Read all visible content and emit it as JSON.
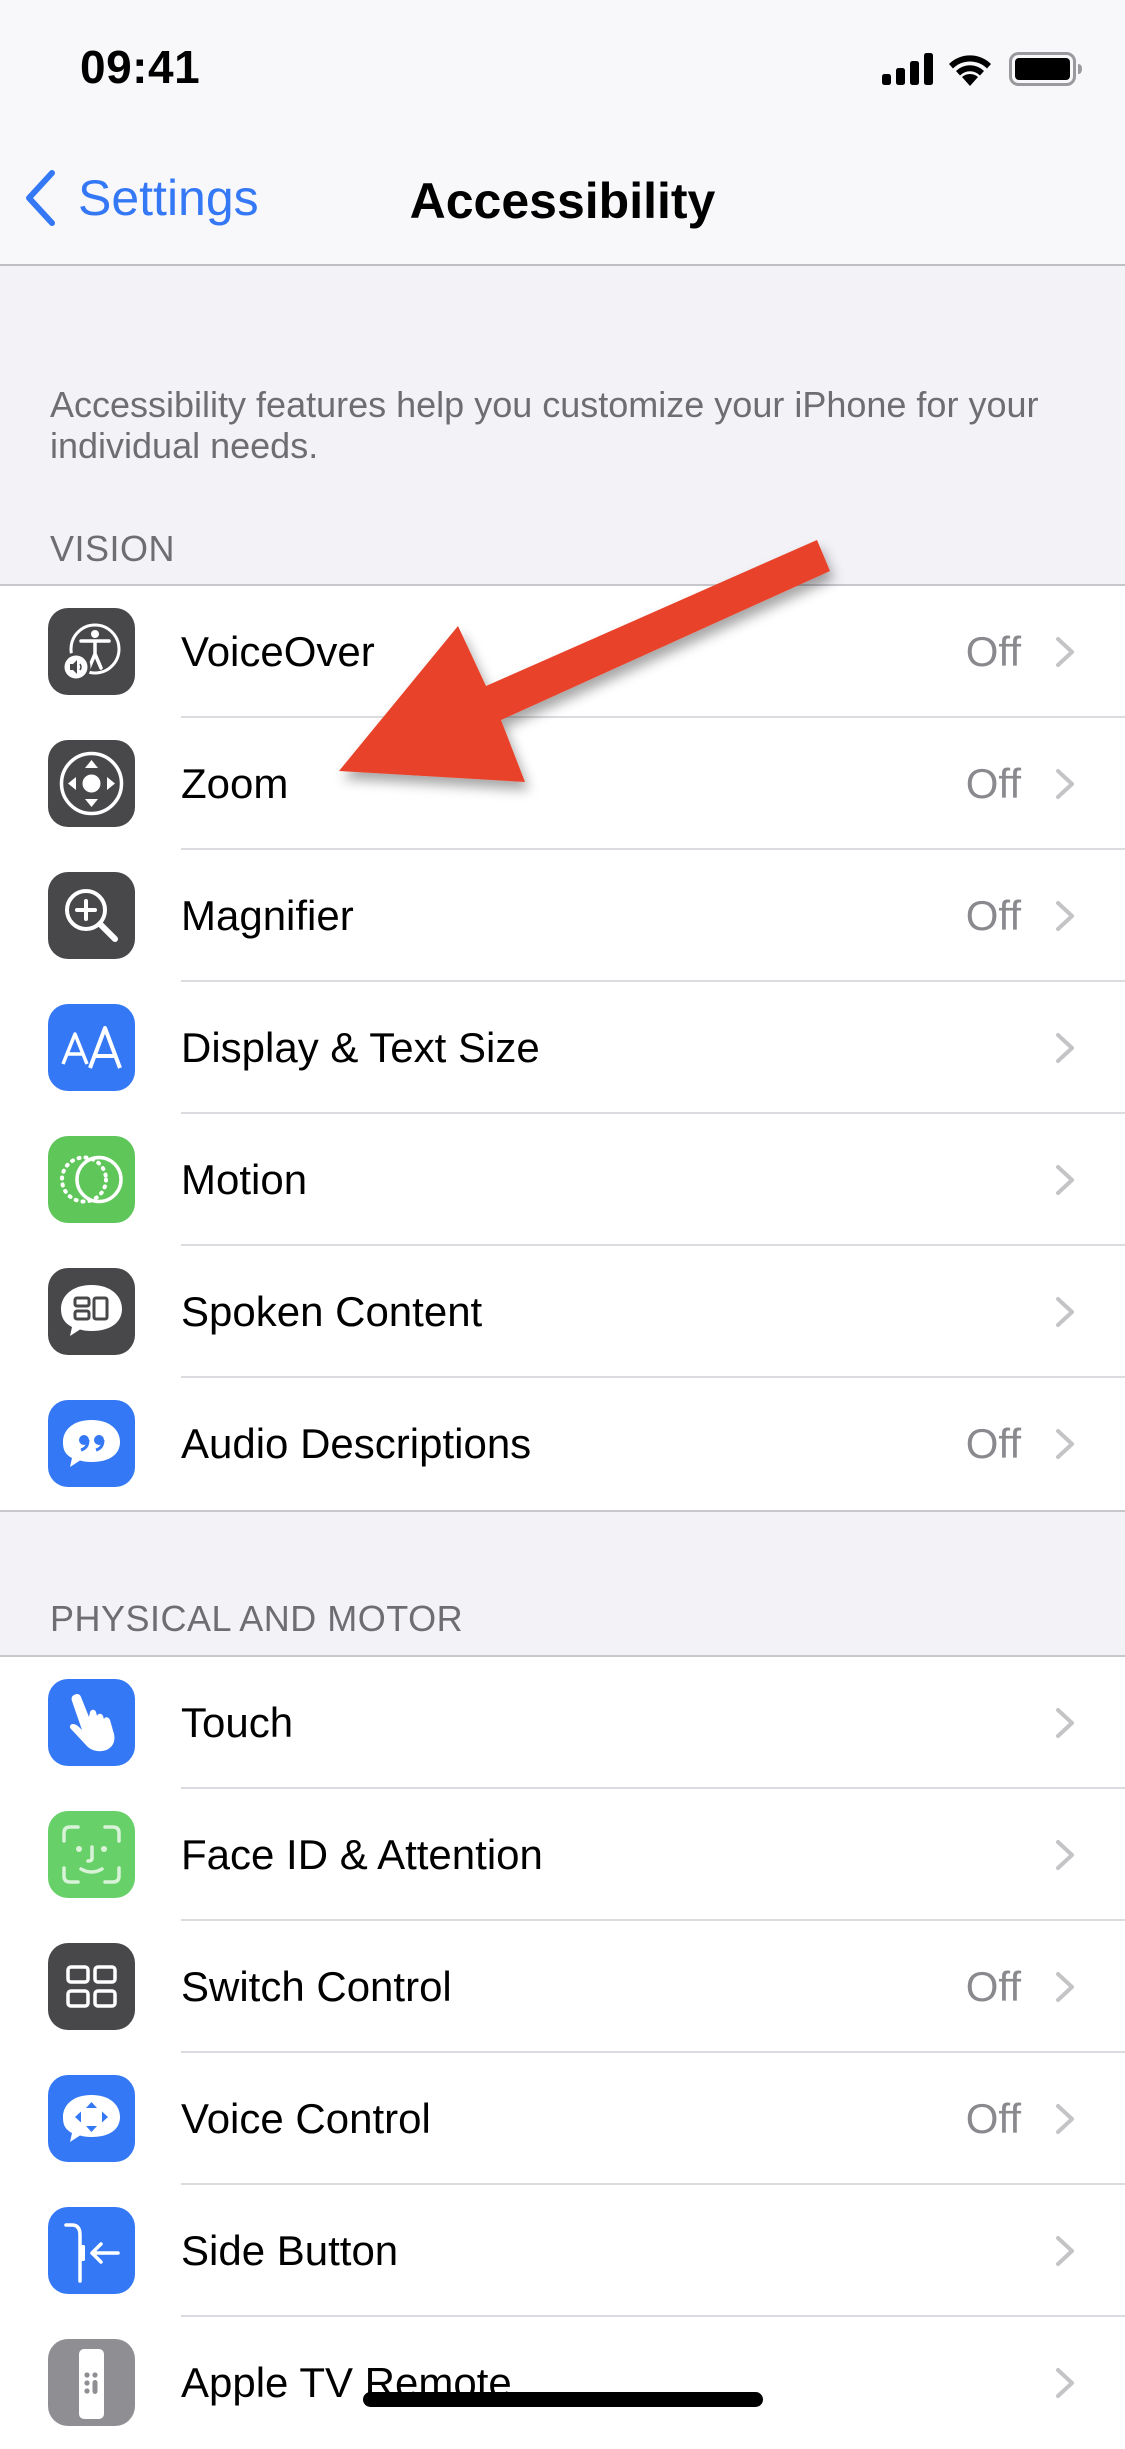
{
  "status_bar": {
    "time": "09:41",
    "icons": [
      "cellular-signal-icon",
      "wifi-icon",
      "battery-icon"
    ]
  },
  "nav": {
    "back_label": "Settings",
    "back_icon": "chevron-left-icon",
    "title": "Accessibility"
  },
  "description": "Accessibility features help you customize your iPhone for your individual needs.",
  "sections": [
    {
      "header": "VISION",
      "items": [
        {
          "label": "VoiceOver",
          "value": "Off",
          "icon": "voiceover-icon",
          "icon_bg": "#48484A"
        },
        {
          "label": "Zoom",
          "value": "Off",
          "icon": "zoom-icon",
          "icon_bg": "#48484A"
        },
        {
          "label": "Magnifier",
          "value": "Off",
          "icon": "magnifier-icon",
          "icon_bg": "#48484A"
        },
        {
          "label": "Display & Text Size",
          "value": "",
          "icon": "text-size-icon",
          "icon_bg": "#3478F6"
        },
        {
          "label": "Motion",
          "value": "",
          "icon": "motion-icon",
          "icon_bg": "#5FC65A"
        },
        {
          "label": "Spoken Content",
          "value": "",
          "icon": "spoken-content-icon",
          "icon_bg": "#48484A"
        },
        {
          "label": "Audio Descriptions",
          "value": "Off",
          "icon": "audio-descriptions-icon",
          "icon_bg": "#3478F6"
        }
      ]
    },
    {
      "header": "PHYSICAL AND MOTOR",
      "items": [
        {
          "label": "Touch",
          "value": "",
          "icon": "touch-hand-icon",
          "icon_bg": "#3478F6"
        },
        {
          "label": "Face ID & Attention",
          "value": "",
          "icon": "face-id-icon",
          "icon_bg": "#68D068"
        },
        {
          "label": "Switch Control",
          "value": "Off",
          "icon": "switch-control-icon",
          "icon_bg": "#48484A"
        },
        {
          "label": "Voice Control",
          "value": "Off",
          "icon": "voice-control-icon",
          "icon_bg": "#3478F6"
        },
        {
          "label": "Side Button",
          "value": "",
          "icon": "side-button-icon",
          "icon_bg": "#3478F6"
        },
        {
          "label": "Apple TV Remote",
          "value": "",
          "icon": "apple-tv-remote-icon",
          "icon_bg": "#8E8E93"
        }
      ]
    }
  ],
  "annotation": {
    "type": "arrow",
    "color": "#E8432A",
    "points_to": "Zoom"
  },
  "colors": {
    "accent": "#3478F6",
    "secondary_text": "#6D6D72",
    "background": "#F2F2F7"
  }
}
